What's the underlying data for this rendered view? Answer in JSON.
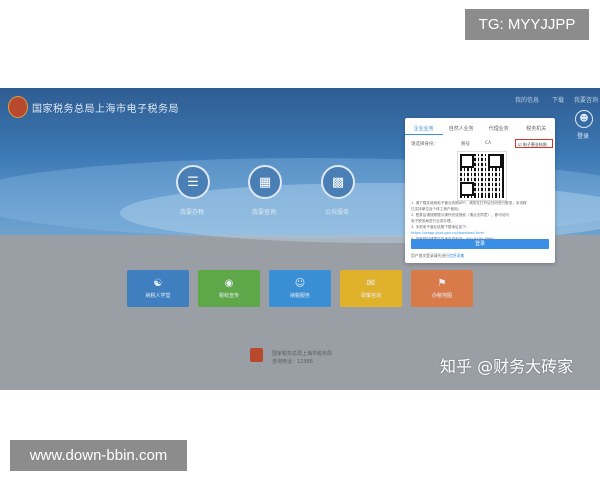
{
  "watermarks": {
    "top": "TG: MYYJJPP",
    "bottom": "www.down-bbin.com",
    "zhihu": "知乎 @财务大砖家"
  },
  "header": {
    "site_title": "国家税务总局上海市电子税务局",
    "links": [
      "我的信息",
      "下载",
      "我要咨询"
    ],
    "user_label": "登录"
  },
  "quick_entries": [
    {
      "icon": "document-icon",
      "label": "我要办税"
    },
    {
      "icon": "calendar-icon",
      "label": "我要查询"
    },
    {
      "icon": "grid-icon",
      "label": "公众服务"
    }
  ],
  "tiles": [
    {
      "icon": "people-icon",
      "label": "纳税人学堂",
      "color": "#3f7fc0"
    },
    {
      "icon": "coin-icon",
      "label": "税收宣传",
      "color": "#5fa84a"
    },
    {
      "icon": "person-icon",
      "label": "纳税服务",
      "color": "#3a8fd4"
    },
    {
      "icon": "chat-icon",
      "label": "政策咨询",
      "color": "#e0b12a"
    },
    {
      "icon": "building-icon",
      "label": "办税地图",
      "color": "#d97a4a"
    }
  ],
  "footer": {
    "org": "国家税务总局上海市税务局",
    "contact": "咨询电话：12366"
  },
  "login_modal": {
    "tabs": [
      "企业业务",
      "自然人业务",
      "代理业务",
      "税务机关"
    ],
    "active_tab": 0,
    "type_label": "请选择身份：",
    "options": [
      "税号",
      "CA",
      "☑ 电子营业执照"
    ],
    "steps": [
      "1. 请下载并使用电子营业执照APP，请您在打开后扫码进行登录，本流程",
      "   已支持单位及个体工商户使用。",
      "2. 登录后请按照提示操作完成授权（请点击同意），即可访问",
      "   电子税务局进行业务办理。",
      "3. 手机电子营业执照下载地址如下：",
      "https://zzapp.gsxt.gov.cn/download.html",
      "4. 如有疑问请拨打技术支持电话：400-9100-8999。"
    ],
    "login_button": "登录",
    "footer_prefix": "用户首次登录请先进行",
    "footer_link": "信息采集"
  },
  "colors": {
    "banner": "#3c78b4",
    "accent": "#3a8ee6",
    "highlight": "#d9342b"
  }
}
